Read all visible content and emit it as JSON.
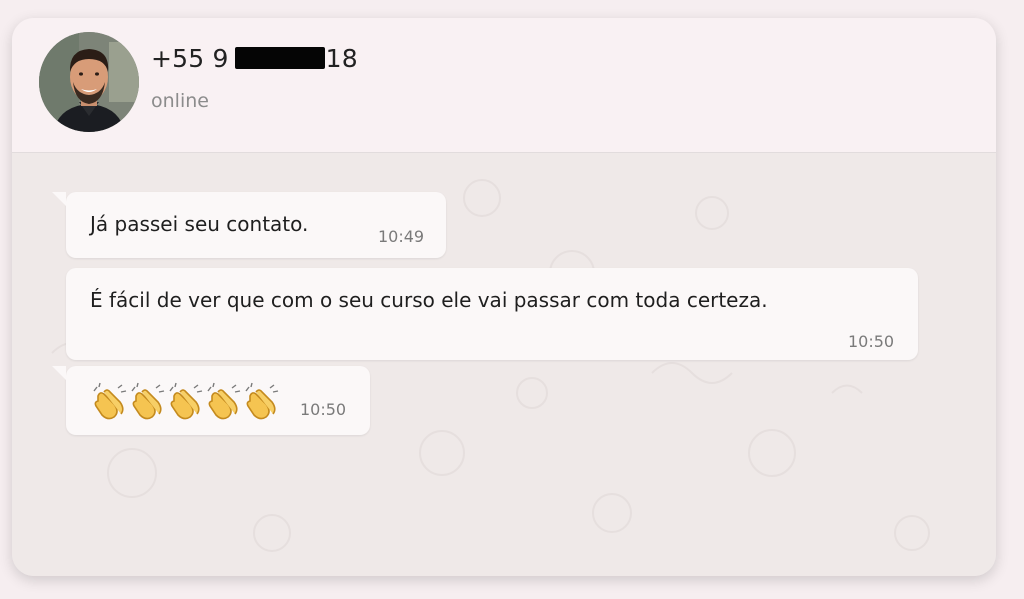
{
  "contact": {
    "phone_prefix": "+55 9",
    "phone_suffix": "18",
    "status": "online"
  },
  "messages": [
    {
      "text": "Já passei seu contato.",
      "time": "10:49"
    },
    {
      "text": "É fácil de ver que com o seu curso ele vai passar com toda certeza.",
      "time": "10:50"
    },
    {
      "emoji": "clapping-hands",
      "count": 5,
      "time": "10:50"
    }
  ],
  "colors": {
    "bubble": "#fbf8f8",
    "chat_background": "#efe9e8",
    "header": "#f9f1f3",
    "clap_emoji": "#f5c451"
  }
}
